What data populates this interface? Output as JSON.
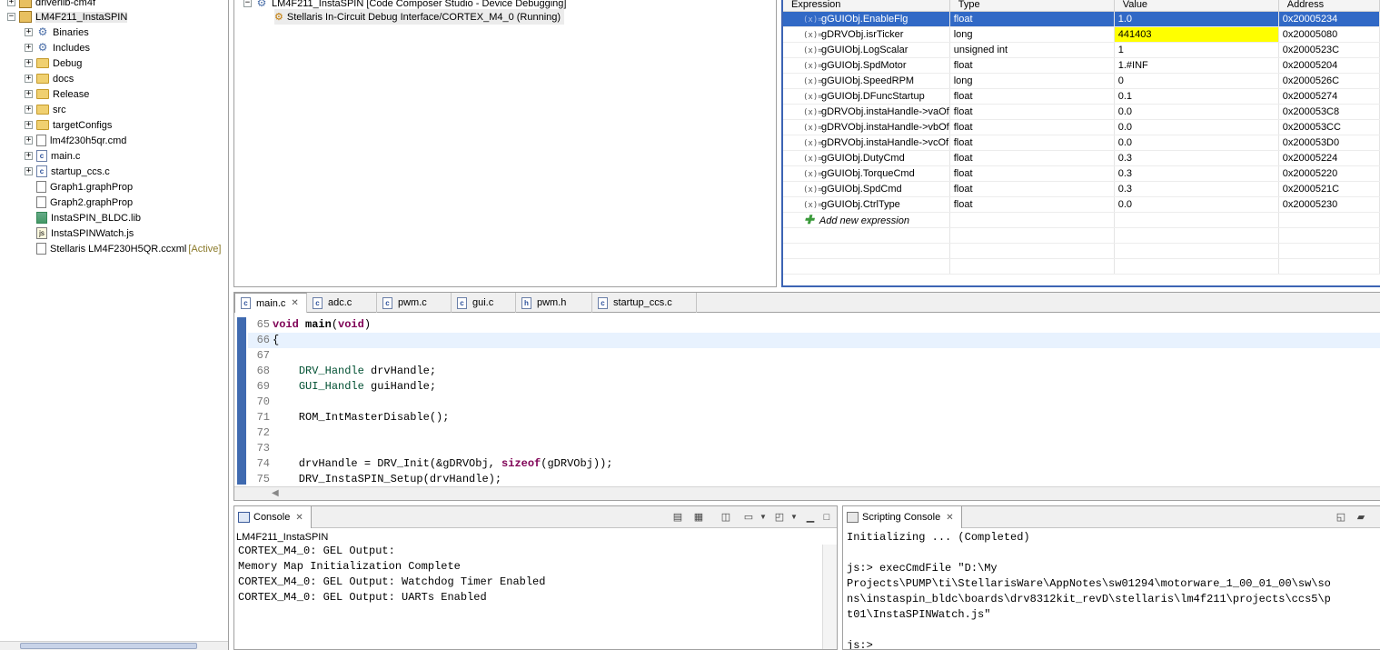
{
  "explorer": {
    "top_item": "driverlib-cm4f",
    "project": "LM4F211_InstaSPIN",
    "items": [
      {
        "label": "Binaries",
        "icon": "binaries-icon",
        "expandable": true
      },
      {
        "label": "Includes",
        "icon": "includes-icon",
        "expandable": true
      },
      {
        "label": "Debug",
        "icon": "folder-icon",
        "expandable": true
      },
      {
        "label": "docs",
        "icon": "folder-icon",
        "expandable": true
      },
      {
        "label": "Release",
        "icon": "folder-icon",
        "expandable": true
      },
      {
        "label": "src",
        "icon": "folder-icon",
        "expandable": true
      },
      {
        "label": "targetConfigs",
        "icon": "folder-icon",
        "expandable": true
      },
      {
        "label": "lm4f230h5qr.cmd",
        "icon": "file-icon",
        "expandable": true
      },
      {
        "label": "main.c",
        "icon": "c-file-icon",
        "expandable": true
      },
      {
        "label": "startup_ccs.c",
        "icon": "c-file-icon",
        "expandable": true
      },
      {
        "label": "Graph1.graphProp",
        "icon": "file-icon",
        "expandable": false
      },
      {
        "label": "Graph2.graphProp",
        "icon": "file-icon",
        "expandable": false
      },
      {
        "label": "InstaSPIN_BLDC.lib",
        "icon": "library-icon",
        "expandable": false
      },
      {
        "label": "InstaSPINWatch.js",
        "icon": "js-file-icon",
        "expandable": false
      },
      {
        "label": "Stellaris LM4F230H5QR.ccxml",
        "icon": "ccxml-file-icon",
        "expandable": false,
        "tag": "[Active]"
      }
    ]
  },
  "debug": {
    "session": "LM4F211_InstaSPIN [Code Composer Studio - Device Debugging]",
    "target": "Stellaris In-Circuit Debug Interface/CORTEX_M4_0 (Running)"
  },
  "expressions": {
    "headers": [
      "Expression",
      "Type",
      "Value",
      "Address"
    ],
    "rows": [
      {
        "expr": "gGUIObj.EnableFlg",
        "type": "float",
        "value": "1.0",
        "address": "0x20005234"
      },
      {
        "expr": "gDRVObj.isrTicker",
        "type": "long",
        "value": "441403",
        "address": "0x20005080"
      },
      {
        "expr": "gGUIObj.LogScalar",
        "type": "unsigned int",
        "value": "1",
        "address": "0x2000523C"
      },
      {
        "expr": "gGUIObj.SpdMotor",
        "type": "float",
        "value": "1.#INF",
        "address": "0x20005204"
      },
      {
        "expr": "gGUIObj.SpeedRPM",
        "type": "long",
        "value": "0",
        "address": "0x2000526C"
      },
      {
        "expr": "gGUIObj.DFuncStartup",
        "type": "float",
        "value": "0.1",
        "address": "0x20005274"
      },
      {
        "expr": "gDRVObj.instaHandle->vaOf",
        "type": "float",
        "value": "0.0",
        "address": "0x200053C8"
      },
      {
        "expr": "gDRVObj.instaHandle->vbOf",
        "type": "float",
        "value": "0.0",
        "address": "0x200053CC"
      },
      {
        "expr": "gDRVObj.instaHandle->vcOf",
        "type": "float",
        "value": "0.0",
        "address": "0x200053D0"
      },
      {
        "expr": "gGUIObj.DutyCmd",
        "type": "float",
        "value": "0.3",
        "address": "0x20005224"
      },
      {
        "expr": "gGUIObj.TorqueCmd",
        "type": "float",
        "value": "0.3",
        "address": "0x20005220"
      },
      {
        "expr": "gGUIObj.SpdCmd",
        "type": "float",
        "value": "0.3",
        "address": "0x2000521C"
      },
      {
        "expr": "gGUIObj.CtrlType",
        "type": "float",
        "value": "0.0",
        "address": "0x20005230"
      }
    ],
    "add_label": "Add new expression",
    "var_icon": "(x)=",
    "selected_color": "#3169c6",
    "changed_color": "#ffff00"
  },
  "editor": {
    "tabs": [
      {
        "label": "main.c",
        "icon": "c-file-icon",
        "active": true
      },
      {
        "label": "adc.c",
        "icon": "c-file-icon"
      },
      {
        "label": "pwm.c",
        "icon": "c-file-icon"
      },
      {
        "label": "gui.c",
        "icon": "c-file-icon"
      },
      {
        "label": "pwm.h",
        "icon": "h-file-icon"
      },
      {
        "label": "startup_ccs.c",
        "icon": "c-file-icon"
      }
    ],
    "lines": [
      {
        "num": "65",
        "html": "<span class=\"kw\">void</span> <b>main</b>(<span class=\"kw\">void</span>)"
      },
      {
        "num": "66",
        "html": "{",
        "current": true
      },
      {
        "num": "67",
        "html": ""
      },
      {
        "num": "68",
        "html": "    <span class=\"ty\">DRV_Handle</span> drvHandle;"
      },
      {
        "num": "69",
        "html": "    <span class=\"ty\">GUI_Handle</span> guiHandle;"
      },
      {
        "num": "70",
        "html": ""
      },
      {
        "num": "71",
        "html": "    ROM_IntMasterDisable();"
      },
      {
        "num": "72",
        "html": ""
      },
      {
        "num": "73",
        "html": ""
      },
      {
        "num": "74",
        "html": "    drvHandle = DRV_Init(&amp;gDRVObj, <span class=\"kw\">sizeof</span>(gDRVObj));"
      },
      {
        "num": "75",
        "html": "    DRV_InstaSPIN_Setup(drvHandle);"
      }
    ]
  },
  "console": {
    "tab": "Console",
    "subtitle": "LM4F211_InstaSPIN",
    "lines": [
      "CORTEX_M4_0: GEL Output:",
      "Memory Map Initialization Complete",
      "CORTEX_M4_0: GEL Output: Watchdog Timer Enabled",
      "CORTEX_M4_0: GEL Output: UARTs Enabled"
    ]
  },
  "scripting": {
    "tab": "Scripting Console",
    "lines": [
      "Initializing ... (Completed)",
      "",
      "js:> execCmdFile \"D:\\My",
      "Projects\\PUMP\\ti\\StellarisWare\\AppNotes\\sw01294\\motorware_1_00_01_00\\sw\\so",
      "ns\\instaspin_bldc\\boards\\drv8312kit_revD\\stellaris\\lm4f211\\projects\\ccs5\\p",
      "t01\\InstaSPINWatch.js\"",
      "",
      "js:>"
    ]
  }
}
